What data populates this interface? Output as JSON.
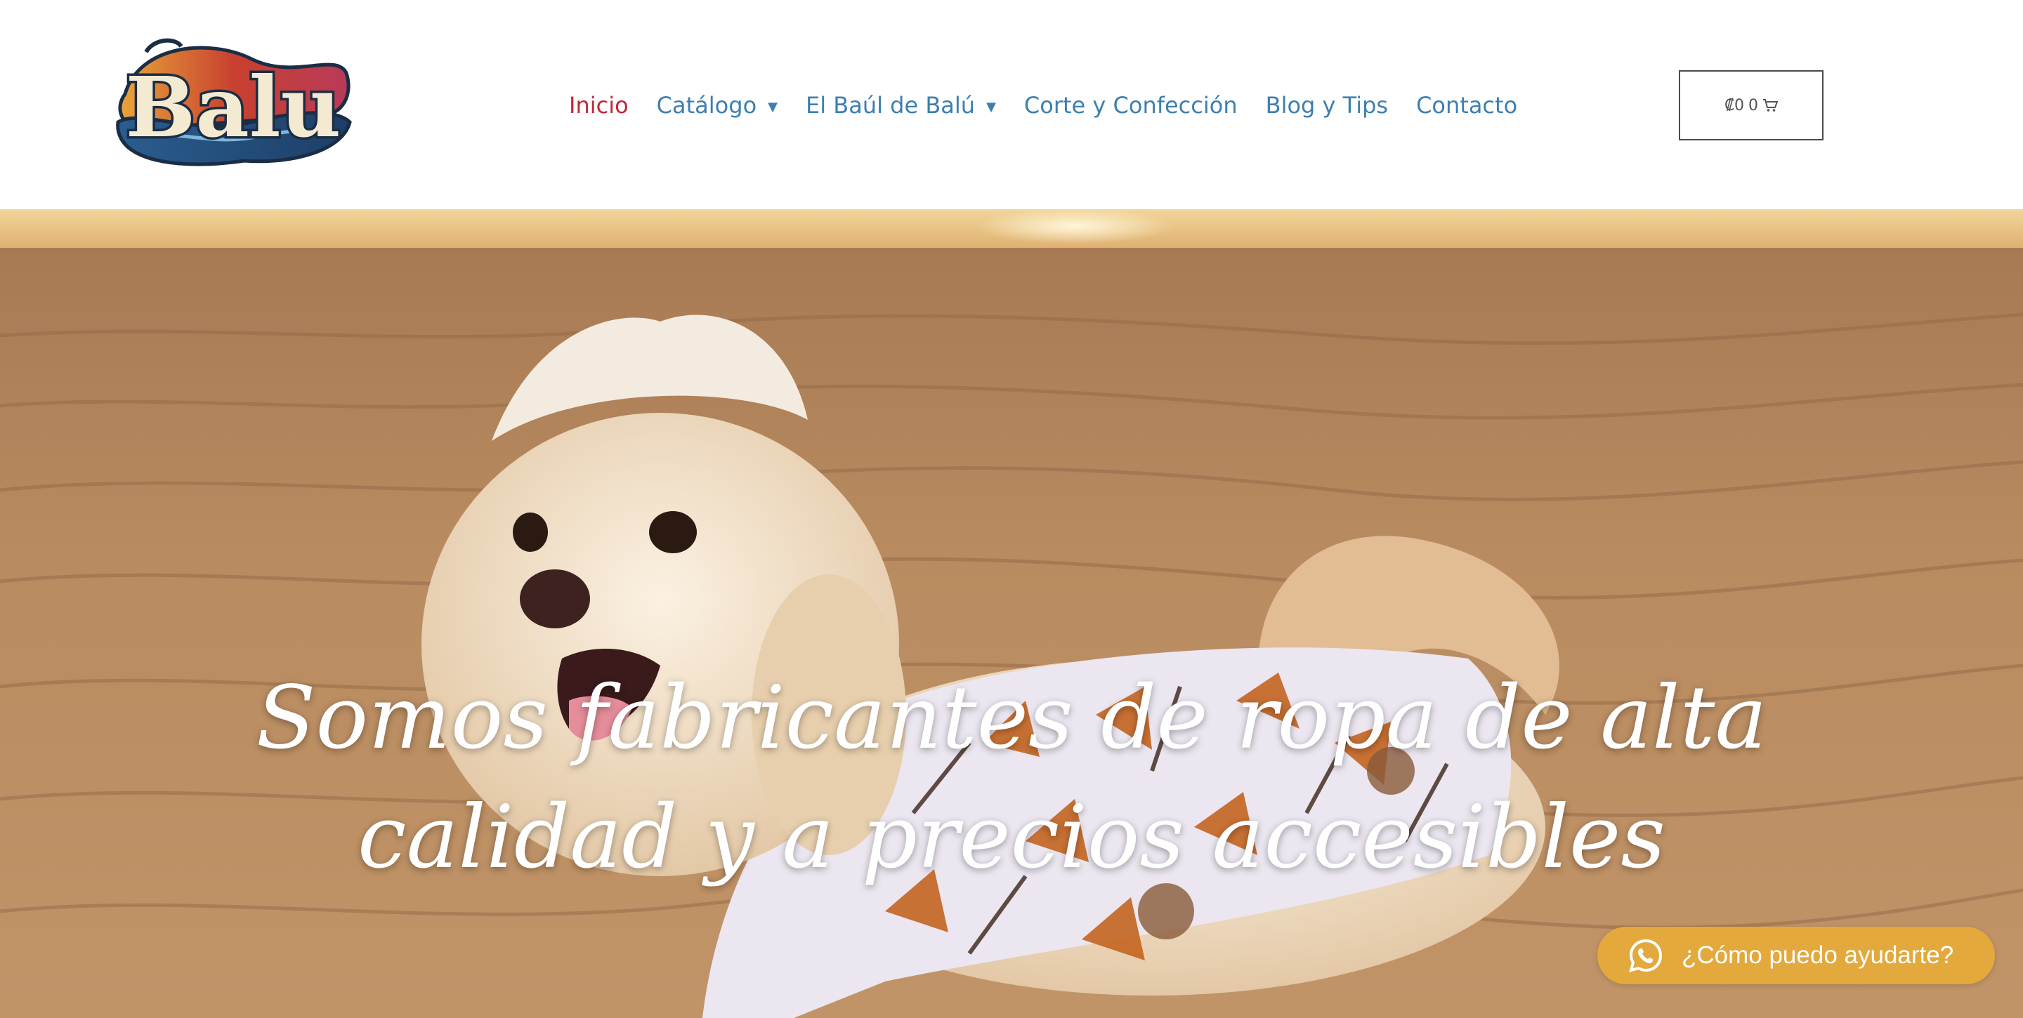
{
  "header": {
    "logo_text": "Balu",
    "nav": [
      {
        "label": "Inicio",
        "active": true,
        "has_dropdown": false
      },
      {
        "label": "Catálogo",
        "active": false,
        "has_dropdown": true
      },
      {
        "label": "El Baúl de Balú",
        "active": false,
        "has_dropdown": true
      },
      {
        "label": "Corte y Confección",
        "active": false,
        "has_dropdown": false
      },
      {
        "label": "Blog y Tips",
        "active": false,
        "has_dropdown": false
      },
      {
        "label": "Contacto",
        "active": false,
        "has_dropdown": false
      }
    ],
    "cart": {
      "amount": "₡0",
      "count": "0",
      "icon": "shopping-cart-icon"
    }
  },
  "hero": {
    "title_line1": "Somos fabricantes de ropa de alta",
    "title_line2": "calidad y a precios accesibles"
  },
  "chat": {
    "label": "¿Cómo puedo ayudarte?",
    "icon": "whatsapp-icon"
  },
  "colors": {
    "nav_link": "#3d7fb0",
    "nav_active": "#c1273a",
    "chat_button": "#e3a93c"
  }
}
